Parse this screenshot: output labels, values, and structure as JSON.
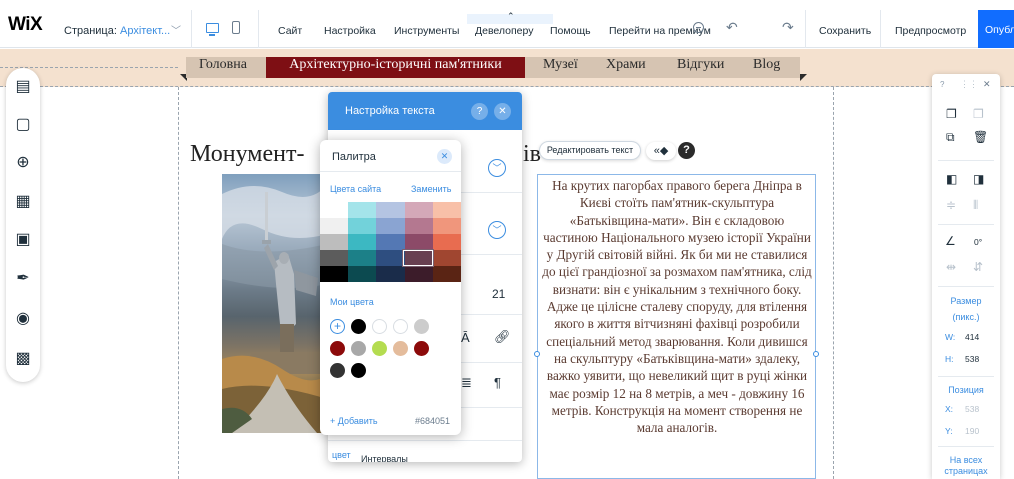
{
  "topbar": {
    "logo": "WiX",
    "page_label": "Страница:",
    "page_value": "Архітект...",
    "menu": [
      "Сайт",
      "Настройка",
      "Инструменты",
      "Девелоперу",
      "Помощь",
      "Перейти на премиум"
    ],
    "save": "Сохранить",
    "preview": "Предпросмотр",
    "publish": "Опубликовать"
  },
  "site_nav": [
    "Головна",
    "Архітектурно-історичні пам'ятники",
    "Музеї",
    "Храми",
    "Відгуки",
    "Blog"
  ],
  "page_heading": "Монумент-",
  "heading_tail": "ів",
  "body_text": "На крутих пагорбах правого берега Дніпра в Києві стоїть пам'ятник-скульптура «Батьківщина-мати». Він є складовою частиною Національного музею історії України у Другій світовій війні. Як би ми не ставилися до цієї грандіозної за розмахом пам'ятника, слід визнати: він є унікальним з технічного боку. Адже це цілісне сталеву споруду, для втілення якого в життя вітчизняні фахівці розробили спеціальний метод зварювання. Коли дивишся на скульптуру «Батьківщина-мати» здалеку, важко уявити, що невеликий щит в руці жінки має розмір 12 на 8 метрів, а меч - довжину 16 метрів. Конструкція на момент створення не мала аналогів.",
  "floating": {
    "edit_text": "Редактировать текст",
    "anim": "«◆",
    "help": "?"
  },
  "text_settings": {
    "title": "Настройка текста",
    "help": "?",
    "close": "✕",
    "font_size": "21",
    "bottom_label": "цвет",
    "bottom_text": "Интервалы"
  },
  "palette": {
    "title": "Палитра",
    "site_colors_label": "Цвета сайта",
    "change": "Заменить",
    "grid": [
      [
        "#ffffff",
        "#a4e4ea",
        "#b4c4e2",
        "#d4a8b8",
        "#f8c0a8"
      ],
      [
        "#f0f0f0",
        "#72d2da",
        "#8aa4d2",
        "#b47890",
        "#f0967c"
      ],
      [
        "#bdbdbd",
        "#3cb8c2",
        "#5478b4",
        "#8c4a68",
        "#e86c50"
      ],
      [
        "#5c5c5c",
        "#1c8088",
        "#2e4e80",
        "#684051",
        "#a04630"
      ],
      [
        "#000000",
        "#0c4a50",
        "#1a2c4a",
        "#3c1c2a",
        "#5a2414"
      ]
    ],
    "my_colors_label": "Мои цвета",
    "my_colors": [
      "#000000",
      "#ffffff",
      "#ffffff",
      "#cccccc",
      "#8c0a0a",
      "#a8a8a8",
      "#b4dc50",
      "#e4bc9c",
      "#8c0a0a",
      "#333333",
      "#000000"
    ],
    "add": "+ Добавить",
    "hex": "#684051"
  },
  "right_panel": {
    "size_label": "Размер",
    "size_unit": "(пикс.)",
    "w_label": "W:",
    "w_value": "414",
    "h_label": "H:",
    "h_value": "538",
    "position_label": "Позиция",
    "x_label": "X:",
    "x_value": "538",
    "y_label": "Y:",
    "y_value": "190",
    "rotation": "0°",
    "all_pages_1": "На всех",
    "all_pages_2": "страницах"
  }
}
